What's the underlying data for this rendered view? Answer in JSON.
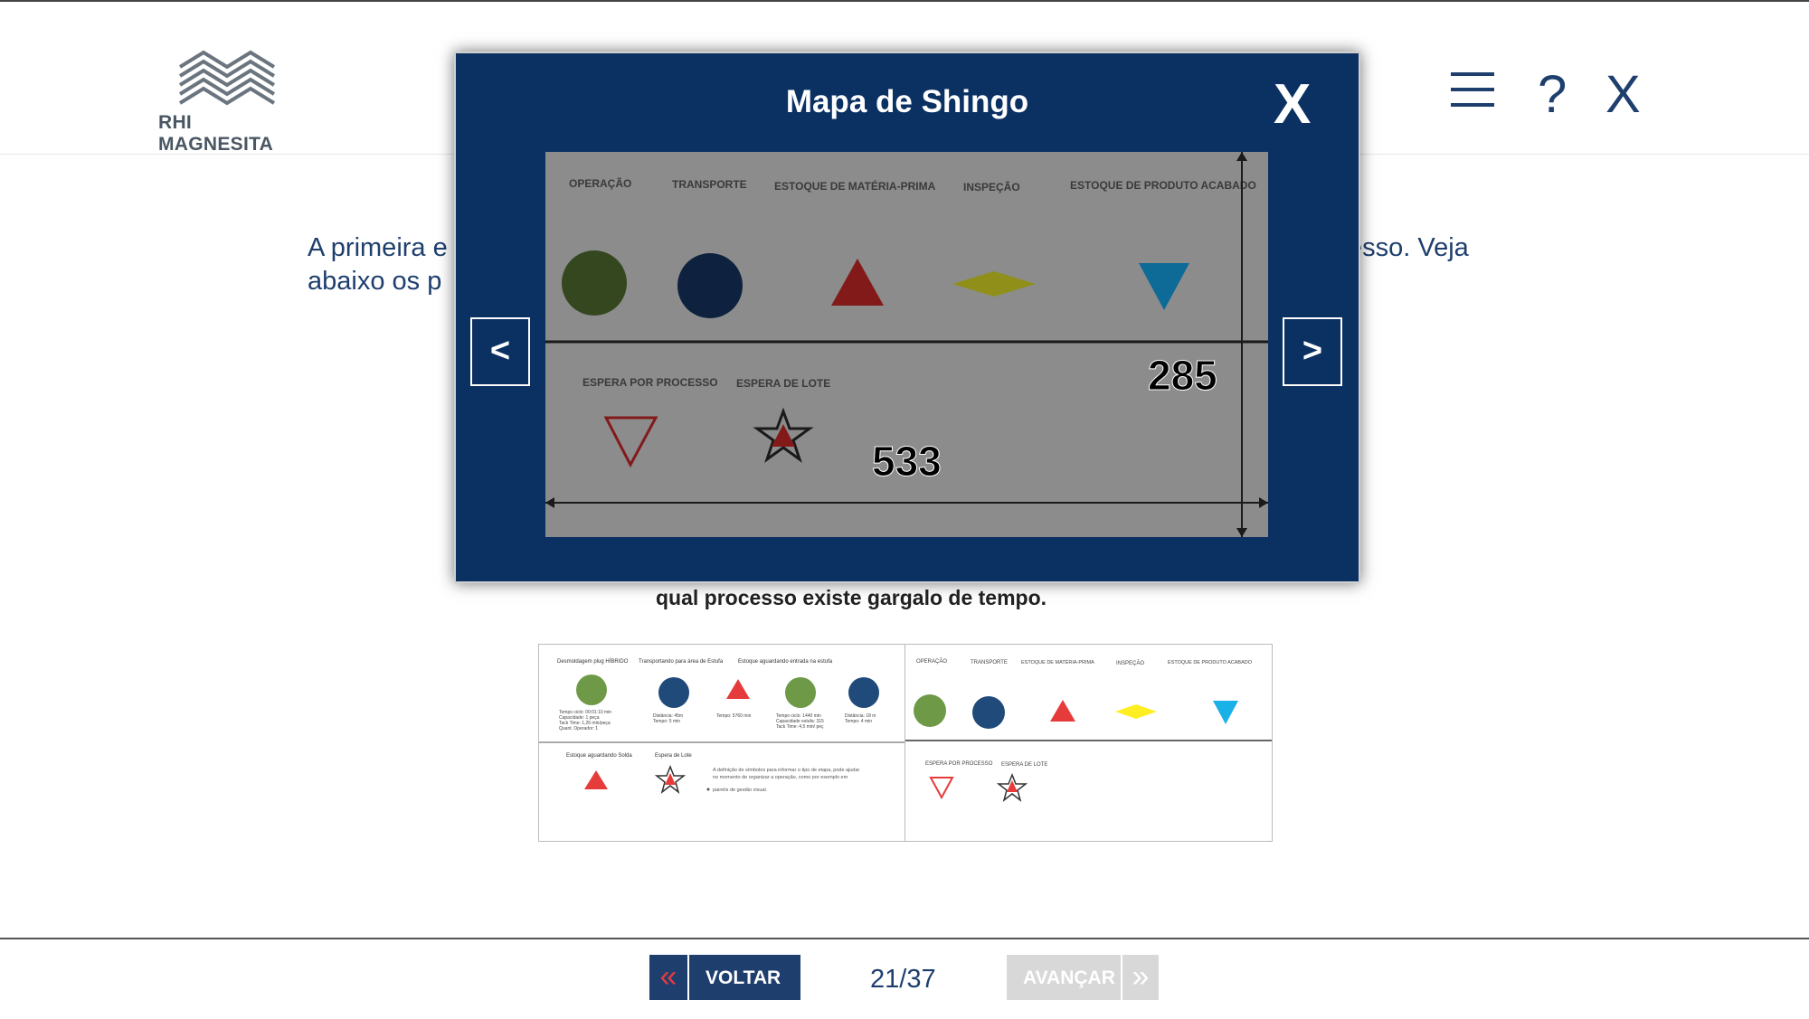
{
  "header": {
    "logo_text": "RHI MAGNESITA",
    "menu_icon": "menu-icon",
    "help_label": "?",
    "close_label": "X"
  },
  "content": {
    "paragraph_line1": "A primeira etapa ... processo. Veja",
    "paragraph_left1": "A primeira e",
    "paragraph_right1": "esso. Veja",
    "paragraph_left2": "abaixo os p",
    "caption": "qual processo existe gargalo de tempo."
  },
  "thumb_a": {
    "headers": [
      "Desmoldagem plug HÍBRIDO",
      "Transportando para área de Estufa",
      "Estoque aguardando entrada na estufa"
    ],
    "info1": [
      "Tempo ciclo: 00:01:10 min",
      "Capacidade: 1 peça",
      "Tack Time: 1,26 min/peça",
      "Quant. Operador: 1"
    ],
    "info2": [
      "Distância: 45m",
      "Tempo: 5 min"
    ],
    "info3": [
      "Tempo: 5760 min"
    ],
    "info4": [
      "Tempo ciclo: 1440 min",
      "Capacidade estufa: 315",
      "Tack Time: 4,5 min/ peç"
    ],
    "info5": [
      "Distância: 18 m",
      "Tempo: 4 min"
    ],
    "row2_labels": [
      "Estoque aguardando Solda",
      "Espera de Lote"
    ],
    "note": [
      "A definição de símbolos para informar o tipo de etapa, pode ajudar",
      "no momento de organizar a operação, como por exemplo em",
      "painéis de gestão visual."
    ]
  },
  "shingo": {
    "labels_row1": [
      "OPERAÇÃO",
      "TRANSPORTE",
      "ESTOQUE DE MATÉRIA-PRIMA",
      "INSPEÇÃO",
      "ESTOQUE DE PRODUTO ACABADO"
    ],
    "labels_row2": [
      "ESPERA POR PROCESSO",
      "ESPERA DE LOTE"
    ],
    "dim_height": "285",
    "dim_width": "533"
  },
  "modal": {
    "title": "Mapa de Shingo",
    "close_label": "X",
    "prev_label": "<",
    "next_label": ">"
  },
  "footer": {
    "back_label": "VOLTAR",
    "back_icon": "«",
    "page_count": "21/37",
    "next_label": "AVANÇAR",
    "next_icon": "»"
  },
  "colors": {
    "brand_blue": "#1e3f6e",
    "modal_bg": "#0b3163",
    "operation_green": "#6e9a47",
    "transport_navy": "#1f4a7a",
    "stock_red": "#e63b3b",
    "inspection_yellow": "#ffee22",
    "finished_cyan": "#1ab0e8"
  }
}
